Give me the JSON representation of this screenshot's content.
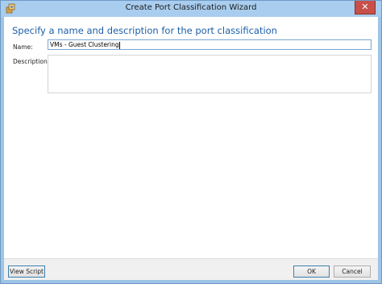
{
  "window": {
    "title": "Create Port Classification Wizard",
    "icon": "wizard-app-icon",
    "close_icon": "close-icon",
    "close_glyph": "✕"
  },
  "content": {
    "heading": "Specify a name and description for the port classification",
    "name_label": "Name:",
    "name_value": "VMs - Guest Clustering",
    "description_label": "Description:",
    "description_value": ""
  },
  "footer": {
    "view_script_label": "View Script",
    "ok_label": "OK",
    "cancel_label": "Cancel"
  },
  "colors": {
    "heading": "#1d5fa8",
    "titlebar": "#a9cdef",
    "close_button": "#c7504a"
  }
}
